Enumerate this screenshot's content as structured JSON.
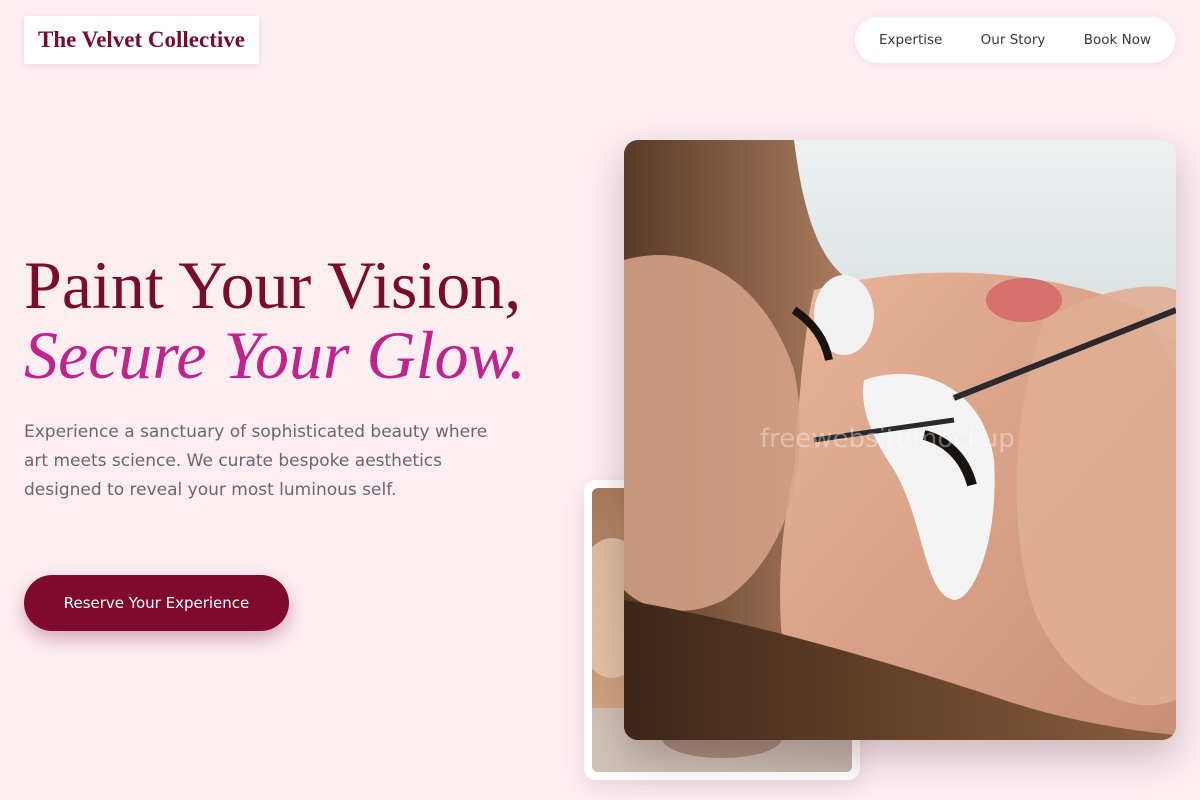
{
  "brand": {
    "logo": "The Velvet Collective"
  },
  "nav": {
    "items": [
      "Expertise",
      "Our Story",
      "Book Now"
    ]
  },
  "hero": {
    "title_line1": "Paint Your Vision,",
    "title_line2": "Secure Your Glow.",
    "description": "Experience a sanctuary of sophisticated beauty where art meets science. We curate bespoke aesthetics designed to reveal your most luminous self.",
    "cta_label": "Reserve Your Experience"
  },
  "images": {
    "main_watermark": "freewebsitemockup"
  },
  "colors": {
    "background": "#fdeef2",
    "brand_wine": "#7a0b2c",
    "accent_magenta": "#c0238d",
    "cta_background": "#7f0a2d",
    "body_text": "#6e6470"
  }
}
